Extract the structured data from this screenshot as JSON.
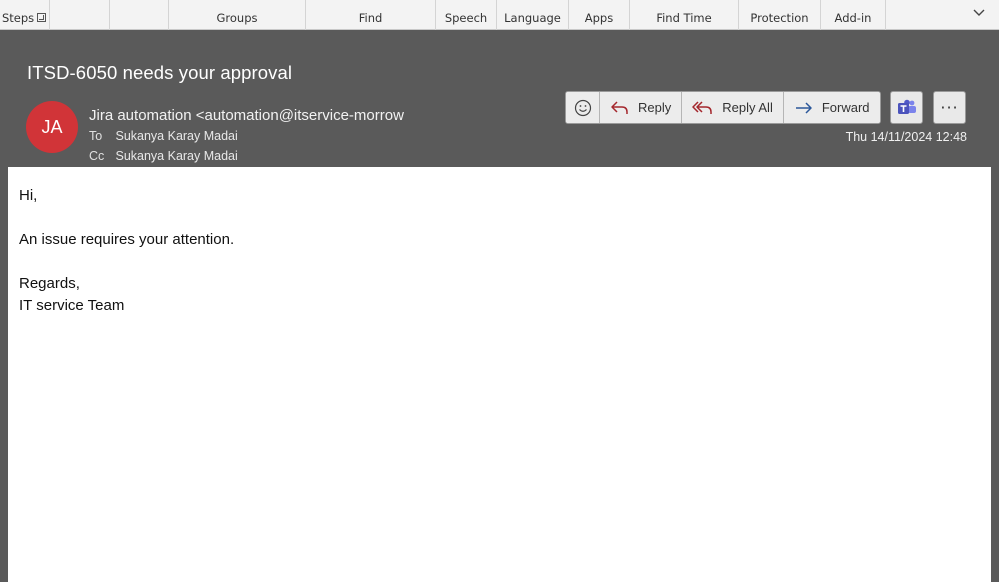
{
  "ribbon": {
    "groups": [
      {
        "label": "Steps"
      },
      {
        "label": ""
      },
      {
        "label": ""
      },
      {
        "label": "Groups"
      },
      {
        "label": "Find"
      },
      {
        "label": "Speech"
      },
      {
        "label": "Language"
      },
      {
        "label": "Apps"
      },
      {
        "label": "Find Time"
      },
      {
        "label": "Protection"
      },
      {
        "label": "Add-in"
      }
    ],
    "collapse_icon": "chevron-down-icon"
  },
  "message": {
    "subject": "ITSD-6050 needs your approval",
    "avatar_initials": "JA",
    "avatar_color": "#d13438",
    "sender": "Jira automation <automation@itservice-morrow",
    "to_label": "To",
    "to": "Sukanya Karay Madai",
    "cc_label": "Cc",
    "cc": "Sukanya Karay Madai",
    "date": "Thu 14/11/2024 12:48"
  },
  "actions": {
    "emoji_icon": "smiley-icon",
    "reply": "Reply",
    "reply_all": "Reply All",
    "forward": "Forward",
    "teams_icon": "teams-icon",
    "more": "···"
  },
  "body": {
    "greeting": "Hi,",
    "line1": "An issue requires your attention.",
    "signoff": "Regards,",
    "signature": "IT service Team"
  },
  "colors": {
    "header_bg": "#5a5a5a",
    "reply_accent": "#a4262c",
    "forward_accent": "#2b579a",
    "teams": "#5059c9"
  }
}
